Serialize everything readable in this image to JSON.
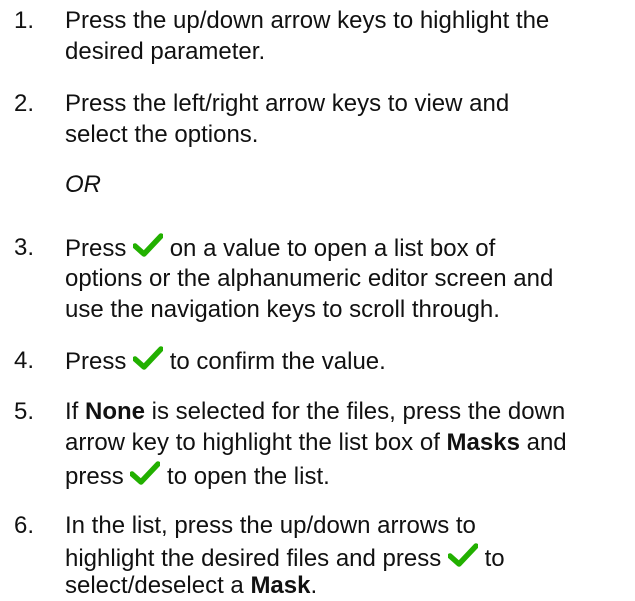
{
  "steps": [
    {
      "number": "1.",
      "lines": [
        "Press the up/down arrow keys to highlight the",
        "desired parameter."
      ]
    },
    {
      "number": "2.",
      "lines": [
        "Press the left/right arrow keys to view and",
        "select the options."
      ]
    },
    {
      "or_label": "OR"
    },
    {
      "number": "3.",
      "line1_before": "Press",
      "line1_after": "on a value to open a list box of",
      "lines_rest": [
        "options or the alphanumeric editor screen and",
        "use the navigation keys to scroll through."
      ]
    },
    {
      "number": "4.",
      "before": "Press",
      "after": "to confirm the value."
    },
    {
      "number": "5.",
      "line1_a": "If ",
      "line1_bold": "None",
      "line1_b": " is selected for the files, press the down",
      "line2_a": "arrow key to highlight the list box of ",
      "line2_bold": "Masks",
      "line2_b": " and",
      "line3_before": "press",
      "line3_after": "to open the list."
    },
    {
      "number": "6.",
      "line1": "In the list, press the up/down arrows to",
      "line2_before": "highlight the desired files and press",
      "line2_after": "to",
      "line3_a": "select/deselect a ",
      "line3_bold": "Mask",
      "line3_b": "."
    }
  ],
  "icon": {
    "name": "checkmark-icon",
    "color": "#22b000"
  }
}
